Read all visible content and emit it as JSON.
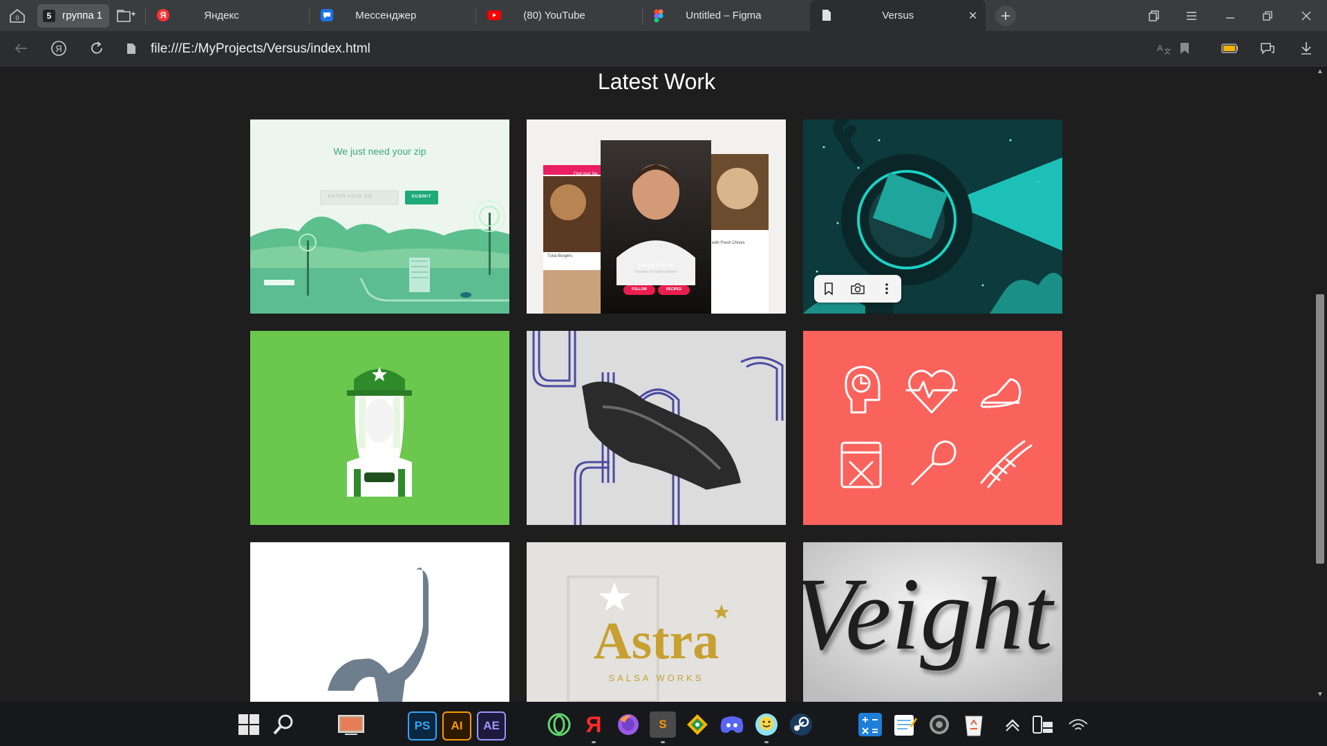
{
  "tabstrip": {
    "group_count": "5",
    "group_label": "группа 1",
    "tabs": [
      {
        "label": "Яндекс",
        "icon": "yandex-icon",
        "active": false
      },
      {
        "label": "Мессенджер",
        "icon": "messenger-icon",
        "active": false
      },
      {
        "label": "(80) YouTube",
        "icon": "youtube-icon",
        "active": false
      },
      {
        "label": "Untitled – Figma",
        "icon": "figma-icon",
        "active": false
      },
      {
        "label": "Versus",
        "icon": "file-icon",
        "active": true
      }
    ]
  },
  "addressbar": {
    "url": "file:///E:/MyProjects/Versus/index.html"
  },
  "page": {
    "section_title": "Latest Work",
    "cards": [
      {
        "name": "zip-landing",
        "title": "We just need your zip",
        "input_placeholder": "ENTER YOUR ZIP",
        "button_label": "SUBMIT",
        "background": "#e8f4ea"
      },
      {
        "name": "chef-app",
        "header": "Find your fav",
        "person_name": "Daniel Boulud",
        "person_subtitle": "Founder of Daniel's kitchen",
        "follow_label": "FOLLOW",
        "recipes_label": "RECIPES",
        "left_caption": "Tuna Burgers",
        "right_caption": "with Fresh Chives",
        "background": "#f0f0f0"
      },
      {
        "name": "octopus-illustration",
        "background": "#0c3b3d"
      },
      {
        "name": "hat-character",
        "background": "#6cc64d"
      },
      {
        "name": "handshake-typography",
        "background": "#dcdcdc"
      },
      {
        "name": "health-icons",
        "background": "#f7635c"
      },
      {
        "name": "elephant-logo",
        "background": "#ffffff"
      },
      {
        "name": "astra-salsa",
        "title": "Astra",
        "subtitle": "SALSA WORKS",
        "background": "#e3e2df"
      },
      {
        "name": "weight-lettering",
        "title": "Veight",
        "background": "#e9e9e9"
      }
    ]
  },
  "taskbar": {
    "apps": [
      "start",
      "search",
      "desktop",
      "photoshop",
      "illustrator",
      "after-effects",
      "opera",
      "yandex",
      "firefox",
      "sublime",
      "git",
      "discord",
      "messenger",
      "steam",
      "calculator",
      "notepad",
      "settings",
      "recycle"
    ],
    "ps_label": "PS",
    "ai_label": "AI",
    "ae_label": "AE",
    "s_label": "S",
    "ya_label": "Я"
  }
}
